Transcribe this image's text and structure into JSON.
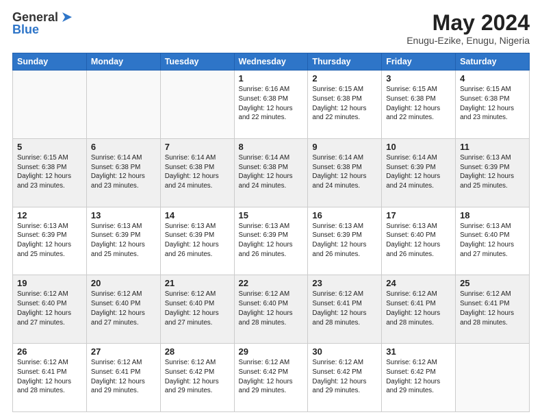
{
  "header": {
    "logo_general": "General",
    "logo_blue": "Blue",
    "month_year": "May 2024",
    "location": "Enugu-Ezike, Enugu, Nigeria"
  },
  "days_of_week": [
    "Sunday",
    "Monday",
    "Tuesday",
    "Wednesday",
    "Thursday",
    "Friday",
    "Saturday"
  ],
  "weeks": [
    [
      {
        "day": "",
        "info": ""
      },
      {
        "day": "",
        "info": ""
      },
      {
        "day": "",
        "info": ""
      },
      {
        "day": "1",
        "info": "Sunrise: 6:16 AM\nSunset: 6:38 PM\nDaylight: 12 hours\nand 22 minutes."
      },
      {
        "day": "2",
        "info": "Sunrise: 6:15 AM\nSunset: 6:38 PM\nDaylight: 12 hours\nand 22 minutes."
      },
      {
        "day": "3",
        "info": "Sunrise: 6:15 AM\nSunset: 6:38 PM\nDaylight: 12 hours\nand 22 minutes."
      },
      {
        "day": "4",
        "info": "Sunrise: 6:15 AM\nSunset: 6:38 PM\nDaylight: 12 hours\nand 23 minutes."
      }
    ],
    [
      {
        "day": "5",
        "info": "Sunrise: 6:15 AM\nSunset: 6:38 PM\nDaylight: 12 hours\nand 23 minutes."
      },
      {
        "day": "6",
        "info": "Sunrise: 6:14 AM\nSunset: 6:38 PM\nDaylight: 12 hours\nand 23 minutes."
      },
      {
        "day": "7",
        "info": "Sunrise: 6:14 AM\nSunset: 6:38 PM\nDaylight: 12 hours\nand 24 minutes."
      },
      {
        "day": "8",
        "info": "Sunrise: 6:14 AM\nSunset: 6:38 PM\nDaylight: 12 hours\nand 24 minutes."
      },
      {
        "day": "9",
        "info": "Sunrise: 6:14 AM\nSunset: 6:38 PM\nDaylight: 12 hours\nand 24 minutes."
      },
      {
        "day": "10",
        "info": "Sunrise: 6:14 AM\nSunset: 6:39 PM\nDaylight: 12 hours\nand 24 minutes."
      },
      {
        "day": "11",
        "info": "Sunrise: 6:13 AM\nSunset: 6:39 PM\nDaylight: 12 hours\nand 25 minutes."
      }
    ],
    [
      {
        "day": "12",
        "info": "Sunrise: 6:13 AM\nSunset: 6:39 PM\nDaylight: 12 hours\nand 25 minutes."
      },
      {
        "day": "13",
        "info": "Sunrise: 6:13 AM\nSunset: 6:39 PM\nDaylight: 12 hours\nand 25 minutes."
      },
      {
        "day": "14",
        "info": "Sunrise: 6:13 AM\nSunset: 6:39 PM\nDaylight: 12 hours\nand 26 minutes."
      },
      {
        "day": "15",
        "info": "Sunrise: 6:13 AM\nSunset: 6:39 PM\nDaylight: 12 hours\nand 26 minutes."
      },
      {
        "day": "16",
        "info": "Sunrise: 6:13 AM\nSunset: 6:39 PM\nDaylight: 12 hours\nand 26 minutes."
      },
      {
        "day": "17",
        "info": "Sunrise: 6:13 AM\nSunset: 6:40 PM\nDaylight: 12 hours\nand 26 minutes."
      },
      {
        "day": "18",
        "info": "Sunrise: 6:13 AM\nSunset: 6:40 PM\nDaylight: 12 hours\nand 27 minutes."
      }
    ],
    [
      {
        "day": "19",
        "info": "Sunrise: 6:12 AM\nSunset: 6:40 PM\nDaylight: 12 hours\nand 27 minutes."
      },
      {
        "day": "20",
        "info": "Sunrise: 6:12 AM\nSunset: 6:40 PM\nDaylight: 12 hours\nand 27 minutes."
      },
      {
        "day": "21",
        "info": "Sunrise: 6:12 AM\nSunset: 6:40 PM\nDaylight: 12 hours\nand 27 minutes."
      },
      {
        "day": "22",
        "info": "Sunrise: 6:12 AM\nSunset: 6:40 PM\nDaylight: 12 hours\nand 28 minutes."
      },
      {
        "day": "23",
        "info": "Sunrise: 6:12 AM\nSunset: 6:41 PM\nDaylight: 12 hours\nand 28 minutes."
      },
      {
        "day": "24",
        "info": "Sunrise: 6:12 AM\nSunset: 6:41 PM\nDaylight: 12 hours\nand 28 minutes."
      },
      {
        "day": "25",
        "info": "Sunrise: 6:12 AM\nSunset: 6:41 PM\nDaylight: 12 hours\nand 28 minutes."
      }
    ],
    [
      {
        "day": "26",
        "info": "Sunrise: 6:12 AM\nSunset: 6:41 PM\nDaylight: 12 hours\nand 28 minutes."
      },
      {
        "day": "27",
        "info": "Sunrise: 6:12 AM\nSunset: 6:41 PM\nDaylight: 12 hours\nand 29 minutes."
      },
      {
        "day": "28",
        "info": "Sunrise: 6:12 AM\nSunset: 6:42 PM\nDaylight: 12 hours\nand 29 minutes."
      },
      {
        "day": "29",
        "info": "Sunrise: 6:12 AM\nSunset: 6:42 PM\nDaylight: 12 hours\nand 29 minutes."
      },
      {
        "day": "30",
        "info": "Sunrise: 6:12 AM\nSunset: 6:42 PM\nDaylight: 12 hours\nand 29 minutes."
      },
      {
        "day": "31",
        "info": "Sunrise: 6:12 AM\nSunset: 6:42 PM\nDaylight: 12 hours\nand 29 minutes."
      },
      {
        "day": "",
        "info": ""
      }
    ]
  ]
}
